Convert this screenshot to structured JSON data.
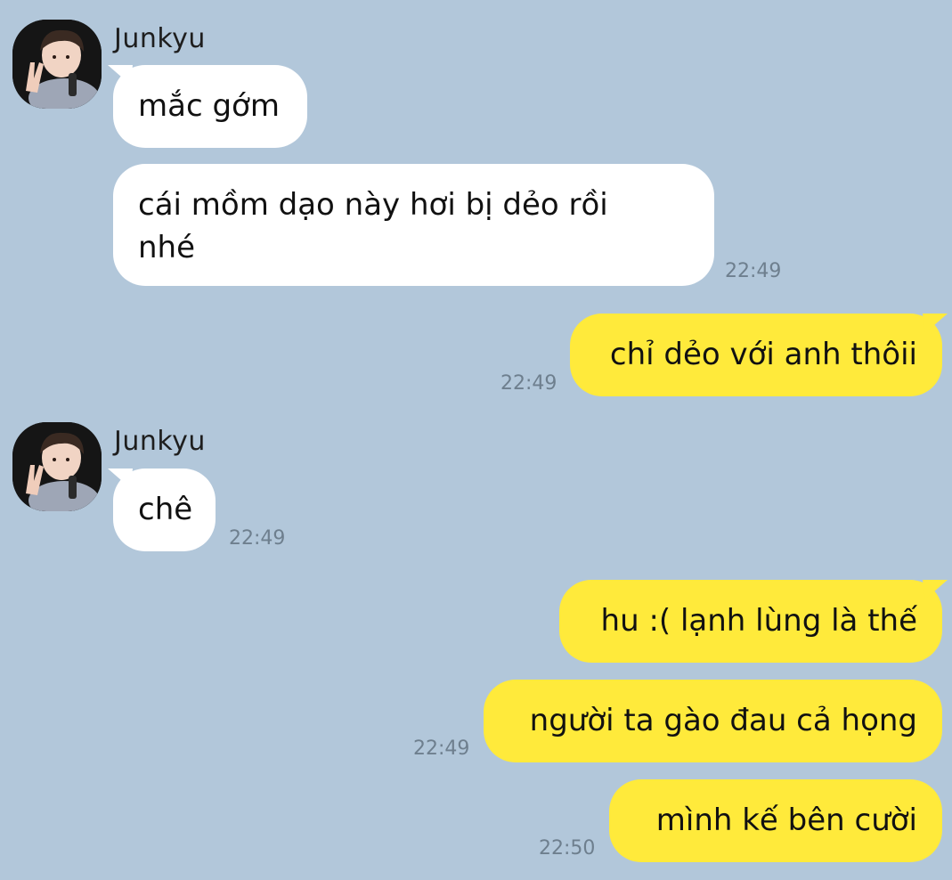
{
  "chat": {
    "messages": [
      {
        "sender": "Junkyu",
        "text": "mắc gớm",
        "time": ""
      },
      {
        "sender": "Junkyu",
        "text": "cái mồm dạo này hơi bị dẻo rồi\nnhé",
        "time": "22:49"
      },
      {
        "sender": "me",
        "text": "chỉ dẻo với anh thôii",
        "time": "22:49"
      },
      {
        "sender": "Junkyu",
        "text": "chê",
        "time": "22:49"
      },
      {
        "sender": "me",
        "text": "hu :( lạnh lùng là thế",
        "time": ""
      },
      {
        "sender": "me",
        "text": "người ta gào đau cả họng",
        "time": "22:49"
      },
      {
        "sender": "me",
        "text": "mình kế bên cười",
        "time": "22:50"
      }
    ],
    "contact_name": "Junkyu",
    "colors": {
      "background": "#b2c7da",
      "incoming_bubble": "#ffffff",
      "outgoing_bubble": "#ffea3b",
      "timestamp": "#6e7f8e"
    },
    "avatar_icon": "profile-photo-icon"
  }
}
